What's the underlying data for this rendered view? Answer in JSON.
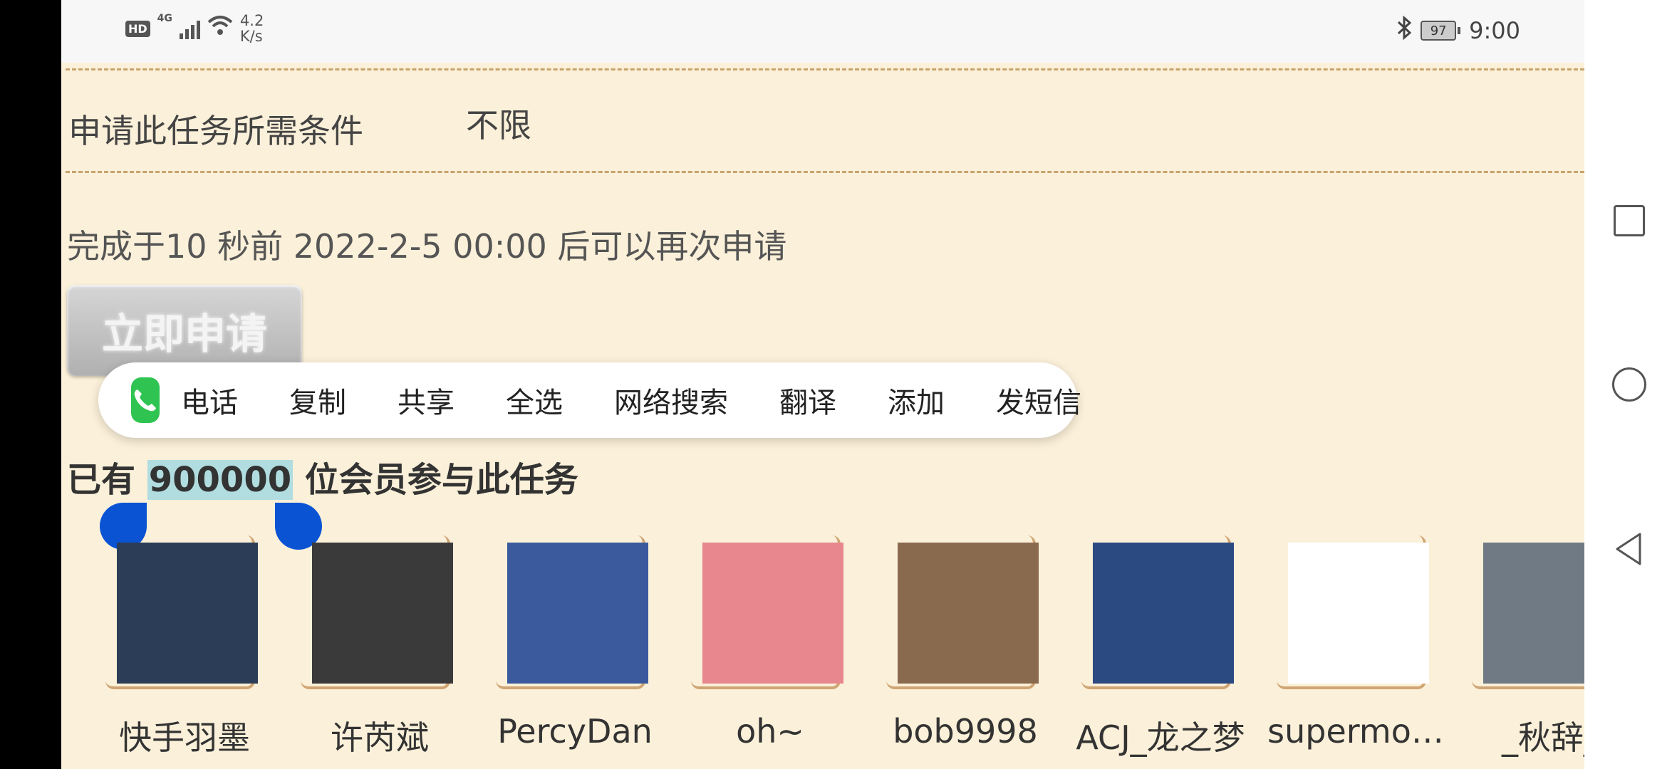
{
  "status_bar": {
    "hd": "HD",
    "network": "4G",
    "speed": "4.2 K/s",
    "speed_value": "4.2",
    "speed_unit": "K/s",
    "battery": "97",
    "time": "9:00"
  },
  "task": {
    "requirement_label": "申请此任务所需条件",
    "requirement_value": "不限",
    "completed_text": "完成于10 秒前   2022-2-5 00:00 后可以再次申请",
    "apply_button": "立即申请"
  },
  "context_menu": {
    "items": [
      "电话",
      "复制",
      "共享",
      "全选",
      "网络搜索",
      "翻译",
      "添加",
      "发短信"
    ]
  },
  "members": {
    "prefix": "已有 ",
    "count": "900000",
    "suffix": " 位会员参与此任务"
  },
  "avatars": [
    {
      "name": "快手羽墨",
      "color": "#2c3d57"
    },
    {
      "name": "许芮斌",
      "color": "#3a3a3a"
    },
    {
      "name": "PercyDan",
      "color": "#3b5a9e"
    },
    {
      "name": "oh~",
      "color": "#e8878d"
    },
    {
      "name": "bob9998",
      "color": "#8a6a4e"
    },
    {
      "name": "ACJ_龙之梦",
      "color": "#2c4a82"
    },
    {
      "name": "supermo…",
      "color": "#ffffff"
    },
    {
      "name": "_秋辞_",
      "color": "#707a84"
    }
  ]
}
